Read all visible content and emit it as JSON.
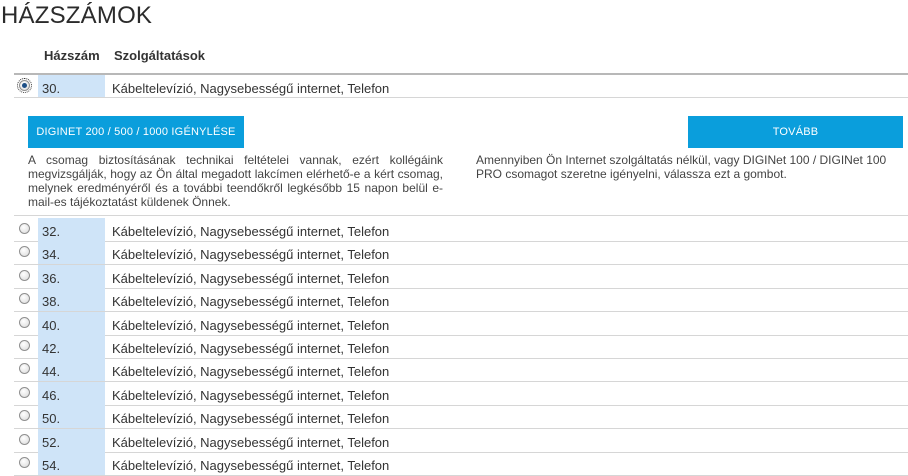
{
  "page": {
    "title": "HÁZSZÁMOK"
  },
  "table": {
    "headers": {
      "house_number": "Házszám",
      "services": "Szolgáltatások"
    },
    "selected_row": {
      "number": "30.",
      "services": "Kábeltelevízió, Nagysebességű internet, Telefon",
      "checked": true
    },
    "rows": [
      {
        "number": "32.",
        "services": "Kábeltelevízió, Nagysebességű internet, Telefon"
      },
      {
        "number": "34.",
        "services": "Kábeltelevízió, Nagysebességű internet, Telefon"
      },
      {
        "number": "36.",
        "services": "Kábeltelevízió, Nagysebességű internet, Telefon"
      },
      {
        "number": "38.",
        "services": "Kábeltelevízió, Nagysebességű internet, Telefon"
      },
      {
        "number": "40.",
        "services": "Kábeltelevízió, Nagysebességű internet, Telefon"
      },
      {
        "number": "42.",
        "services": "Kábeltelevízió, Nagysebességű internet, Telefon"
      },
      {
        "number": "44.",
        "services": "Kábeltelevízió, Nagysebességű internet, Telefon"
      },
      {
        "number": "46.",
        "services": "Kábeltelevízió, Nagysebességű internet, Telefon"
      },
      {
        "number": "50.",
        "services": "Kábeltelevízió, Nagysebességű internet, Telefon"
      },
      {
        "number": "52.",
        "services": "Kábeltelevízió, Nagysebességű internet, Telefon"
      },
      {
        "number": "54.",
        "services": "Kábeltelevízió, Nagysebességű internet, Telefon"
      }
    ]
  },
  "actions": {
    "order_button": "DIGINET 200 / 500 / 1000 IGÉNYLÉSE",
    "order_note": "A csomag biztosításának technikai feltételei vannak, ezért kollégáink megvizsgálják, hogy az Ön által megadott lakcímen elérhető-e a kért csomag, melynek eredményéről és a további teendőkről legkésőbb 15 napon belül e-mail-es tájékoztatást küldenek Önnek.",
    "next_button": "TOVÁBB",
    "next_note": "Amennyiben Ön Internet szolgáltatás nélkül, vagy DIGINet 100 / DIGINet 100 PRO csomagot szeretne igényelni, válassza ezt a gombot."
  },
  "colors": {
    "accent": "#0a9edc",
    "number_cell": "#cfe4f8"
  }
}
